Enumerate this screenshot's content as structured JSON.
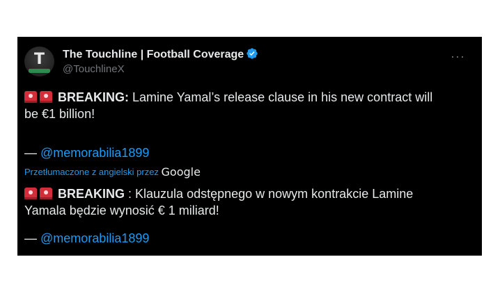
{
  "tweet": {
    "display_name": "The Touchline | Football Coverage",
    "handle": "@TouchlineX",
    "avatar_letter": "T",
    "more_label": "···",
    "original": {
      "lead": "BREAKING:",
      "text_line1": " Lamine Yamal’s release clause in his new contract will",
      "text_line2": "be €1 billion!",
      "credit_prefix": "— ",
      "credit_link": "@memorabilia1899"
    },
    "translation_notice": {
      "text": "Przetłumaczone z angielski przez ",
      "provider": "Google"
    },
    "translated": {
      "lead": "BREAKING",
      "text_line1": " : Klauzula odstępnego w nowym kontrakcie Lamine",
      "text_line2": "Yamala będzie wynosić € 1 miliard!",
      "credit_prefix": "— ",
      "credit_link": "@memorabilia1899"
    }
  },
  "colors": {
    "background": "#000000",
    "text": "#e7e9ea",
    "muted": "#71767b",
    "link": "#1d9bf0",
    "siren": "#d32d3c",
    "verified": "#1d9bf0"
  },
  "icons": {
    "siren": "police-car-light-emoji",
    "verified": "verified-badge-icon",
    "more": "more-horizontal-icon"
  }
}
